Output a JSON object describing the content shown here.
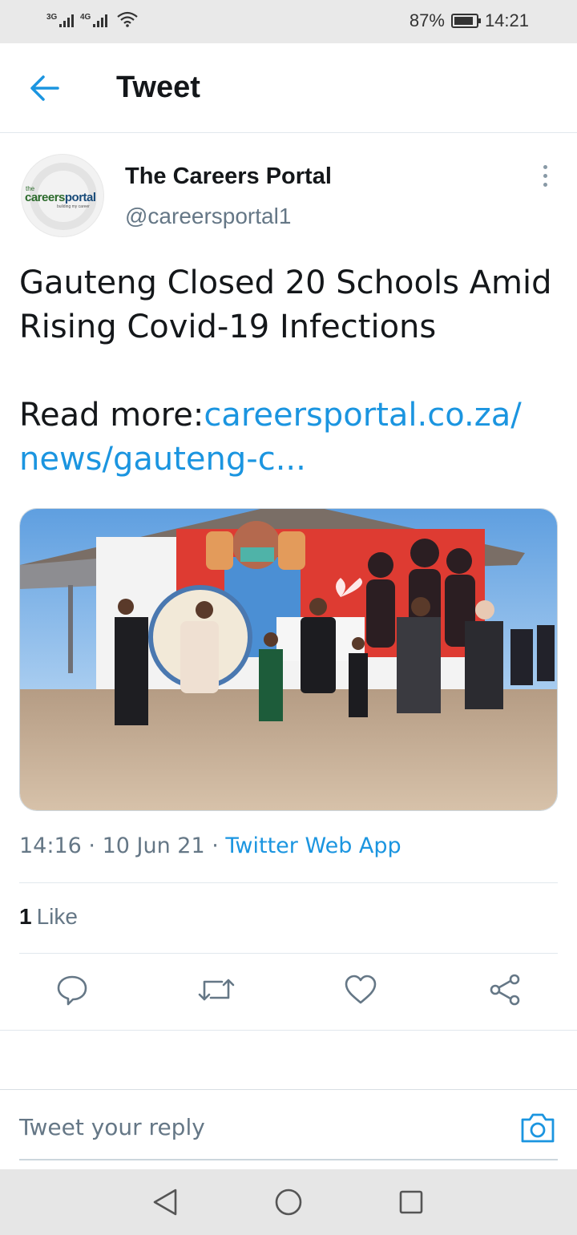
{
  "status_bar": {
    "network1": "3G",
    "network2": "4G",
    "battery_percent": "87%",
    "battery_level": 0.87,
    "time": "14:21",
    "icons": [
      "signal-icon",
      "wifi-icon",
      "battery-icon"
    ]
  },
  "header": {
    "title": "Tweet",
    "back_icon": "arrow-left-icon"
  },
  "author": {
    "name": "The Careers Portal",
    "handle": "@careersportal1",
    "avatar_logo": {
      "prefix": "the",
      "brand_a": "careers",
      "brand_b": "portal",
      "tagline": "building my career"
    }
  },
  "tweet": {
    "line1": "Gauteng Closed 20 Schools Amid",
    "line2": "Rising Covid-19 Infections",
    "read_more_label": "Read more:",
    "link_part1": "careersportal.co.za/",
    "link_part2": "news/gauteng-c..."
  },
  "meta": {
    "time": "14:16",
    "date": "10 Jun 21",
    "source": "Twitter Web App",
    "separator": " · "
  },
  "engagement": {
    "like_count": "1",
    "like_label": "Like"
  },
  "actions": [
    "reply-icon",
    "retweet-icon",
    "like-icon",
    "share-icon"
  ],
  "reply": {
    "placeholder": "Tweet your reply"
  },
  "colors": {
    "accent": "#1b95e0",
    "text": "#14171a",
    "muted": "#657786"
  }
}
